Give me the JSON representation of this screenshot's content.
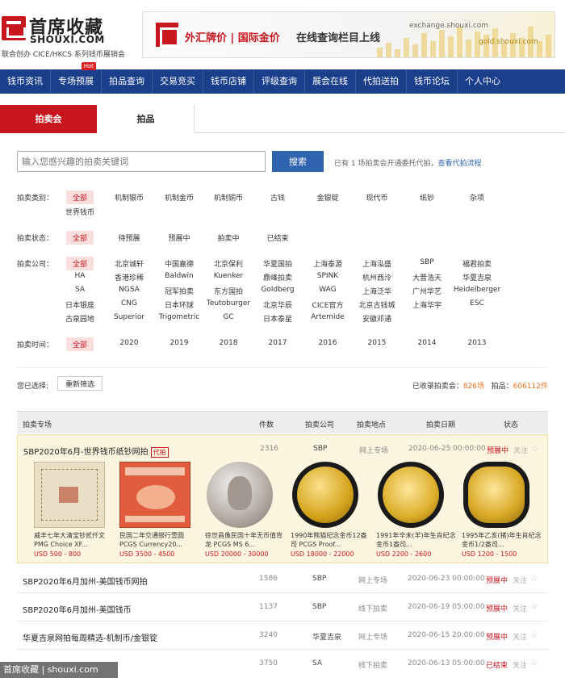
{
  "header": {
    "logo_cn": "首席收藏",
    "logo_en": "SHOUXI.COM",
    "tagline": "联合创办 CICE/HKCS 系列钱币展销会",
    "banner": {
      "fx_text": "外汇牌价 | 国际金价",
      "online_text": "在线查询栏目上线",
      "url1": "exchange.shouxi.com",
      "url2": "gold.shouxi.com"
    }
  },
  "nav": {
    "items": [
      "钱币资讯",
      "专场预展",
      "拍品查询",
      "交易竞买",
      "钱币店铺",
      "评级查询",
      "展会在线",
      "代拍送拍",
      "钱币论坛",
      "个人中心"
    ],
    "hot_badge": "Hot"
  },
  "tabs": [
    "拍卖会",
    "拍品"
  ],
  "search": {
    "placeholder": "输入您感兴趣的拍卖关键词",
    "button": "搜索",
    "info": "已有 1 场拍卖会开通委托代拍，",
    "link": "查看代拍流程"
  },
  "filters": {
    "category": {
      "label": "拍卖类别：",
      "options": [
        "全部",
        "机制银币",
        "机制金币",
        "机制铜币",
        "古钱",
        "金银锭",
        "现代币",
        "纸钞",
        "杂项",
        "世界钱币"
      ]
    },
    "status": {
      "label": "拍卖状态：",
      "options": [
        "全部",
        "待预展",
        "预展中",
        "拍卖中",
        "已结束"
      ]
    },
    "company": {
      "label": "拍卖公司：",
      "options": [
        "全部",
        "北京诚轩",
        "中国嘉德",
        "北京保利",
        "华夏国拍",
        "上海泰源",
        "上海泓盛",
        "SBP",
        "福君拍卖",
        "HA",
        "香港珍稀",
        "Baldwin",
        "Kuenker",
        "鼎峰拍卖",
        "SPINK",
        "杭州西泠",
        "大晋浩天",
        "华夏吉泉",
        "SA",
        "NGSA",
        "冠军拍卖",
        "东方国拍",
        "Goldberg",
        "WAG",
        "上海泛华",
        "广州华艺",
        "Heidelberger",
        "日本银座",
        "CNG",
        "日本环球",
        "Teutoburger",
        "北京华辰",
        "CICE官方",
        "北京古钱城",
        "上海华宇",
        "ESC",
        "古泉园地",
        "Superior",
        "Trigometric",
        "GC",
        "日本泰星",
        "Artemide",
        "安徽邓通"
      ]
    },
    "year": {
      "label": "拍卖时间：",
      "options": [
        "全部",
        "2020",
        "2019",
        "2018",
        "2017",
        "2016",
        "2015",
        "2014",
        "2013"
      ]
    }
  },
  "chosen": {
    "label": "您已选择:",
    "reset": "重新筛选",
    "stats_prefix": "已收录拍卖会：",
    "auction_count": "826场",
    "lots_prefix": "拍品：",
    "lot_count": "606112件"
  },
  "table": {
    "headers": [
      "拍卖专场",
      "件数",
      "拍卖公司",
      "拍卖地点",
      "拍卖日期",
      "状态"
    ],
    "featured": {
      "title": "SBP2020年6月-世界钱币纸钞网拍",
      "tag": "代拍",
      "count": "2316",
      "company": "SBP",
      "place": "网上专场",
      "date": "2020-06-25 00:00:00",
      "status": "预展中",
      "follow": "关注",
      "items": [
        {
          "title": "威丰七年大清宝钞贰仟文 PMG Choice XF...",
          "price": "USD 500 - 800"
        },
        {
          "title": "民国二年交通银行壹圆 PCGS Currency20...",
          "price": "USD 3500 - 4500"
        },
        {
          "title": "徐世昌像民国十年无币值背龙 PCGS MS 6...",
          "price": "USD 20000 - 30000"
        },
        {
          "title": "1990年熊猫纪念金币12盎司 PCGS Proof...",
          "price": "USD 18000 - 22000"
        },
        {
          "title": "1991年辛未(羊)年生肖纪念金币1盎司...",
          "price": "USD 2200 - 2600"
        },
        {
          "title": "1995年乙亥(猪)年生肖纪念金币1/2盎司...",
          "price": "USD 1200 - 1500"
        }
      ]
    },
    "rows": [
      {
        "title": "SBP2020年6月加州-美国钱币网拍",
        "count": "1586",
        "company": "SBP",
        "place": "网上专场",
        "date": "2020-06-23 00:00:00",
        "status": "预展中",
        "follow": "关注"
      },
      {
        "title": "SBP2020年6月加州-美国钱币",
        "count": "1137",
        "company": "SBP",
        "place": "线下拍卖",
        "date": "2020-06-19 05:00:00",
        "status": "预展中",
        "follow": "关注"
      },
      {
        "title": "华夏吉泉网拍每周精选-机制币/金银锭",
        "count": "3240",
        "company": "华夏吉泉",
        "place": "网上专场",
        "date": "2020-06-15 20:00:00",
        "status": "预展中",
        "follow": "关注"
      },
      {
        "title": "",
        "count": "3750",
        "company": "SA",
        "place": "线下拍卖",
        "date": "2020-06-13 05:00:00",
        "status": "已结束",
        "follow": "关注"
      }
    ]
  },
  "watermark": "首席收藏 | shouxi.com",
  "colors": {
    "brand_red": "#c8161e",
    "nav_blue": "#1b3f8b",
    "button_blue": "#2f63b0",
    "stat_orange": "#e8701a"
  }
}
